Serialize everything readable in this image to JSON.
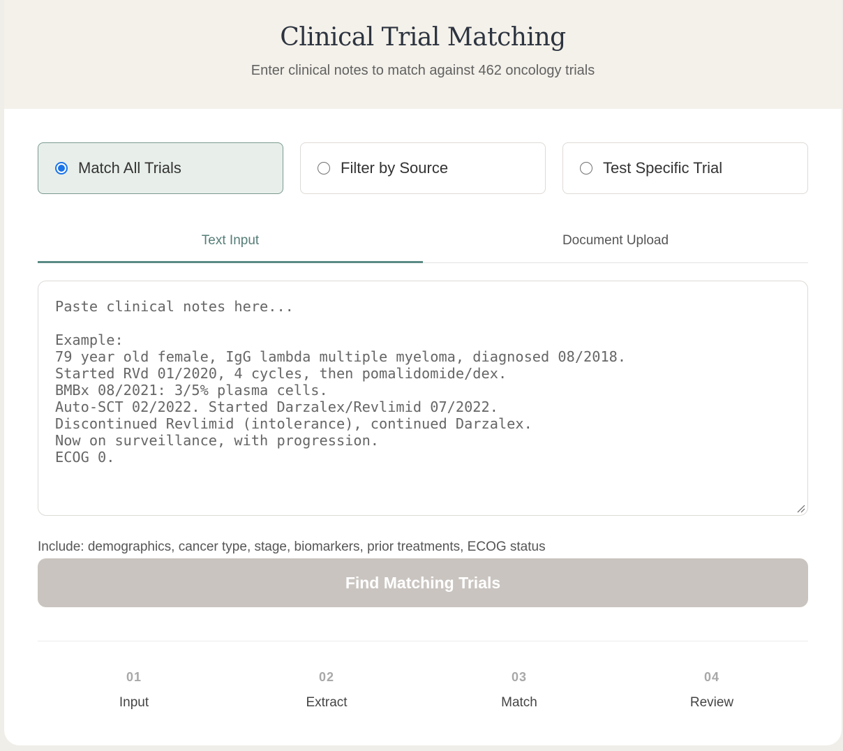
{
  "header": {
    "title": "Clinical Trial Matching",
    "subtitle": "Enter clinical notes to match against 462 oncology trials"
  },
  "modes": [
    {
      "label": "Match All Trials",
      "selected": true
    },
    {
      "label": "Filter by Source",
      "selected": false
    },
    {
      "label": "Test Specific Trial",
      "selected": false
    }
  ],
  "tabs": [
    {
      "label": "Text Input",
      "active": true
    },
    {
      "label": "Document Upload",
      "active": false
    }
  ],
  "notes": {
    "value": "",
    "placeholder": "Paste clinical notes here...\n\nExample:\n79 year old female, IgG lambda multiple myeloma, diagnosed 08/2018.\nStarted RVd 01/2020, 4 cycles, then pomalidomide/dex.\nBMBx 08/2021: 3/5% plasma cells.\nAuto-SCT 02/2022. Started Darzalex/Revlimid 07/2022.\nDiscontinued Revlimid (intolerance), continued Darzalex.\nNow on surveillance, with progression.\nECOG 0."
  },
  "hint": "Include: demographics, cancer type, stage, biomarkers, prior treatments, ECOG status",
  "find_button": {
    "label": "Find Matching Trials",
    "disabled": true
  },
  "steps": [
    {
      "num": "01",
      "label": "Input"
    },
    {
      "num": "02",
      "label": "Extract"
    },
    {
      "num": "03",
      "label": "Match"
    },
    {
      "num": "04",
      "label": "Review"
    }
  ],
  "colors": {
    "header_bg": "#f4f1ea",
    "accent": "#5b8a84",
    "radio_selected": "#1a73e8",
    "button_disabled": "#c9c4bf"
  }
}
